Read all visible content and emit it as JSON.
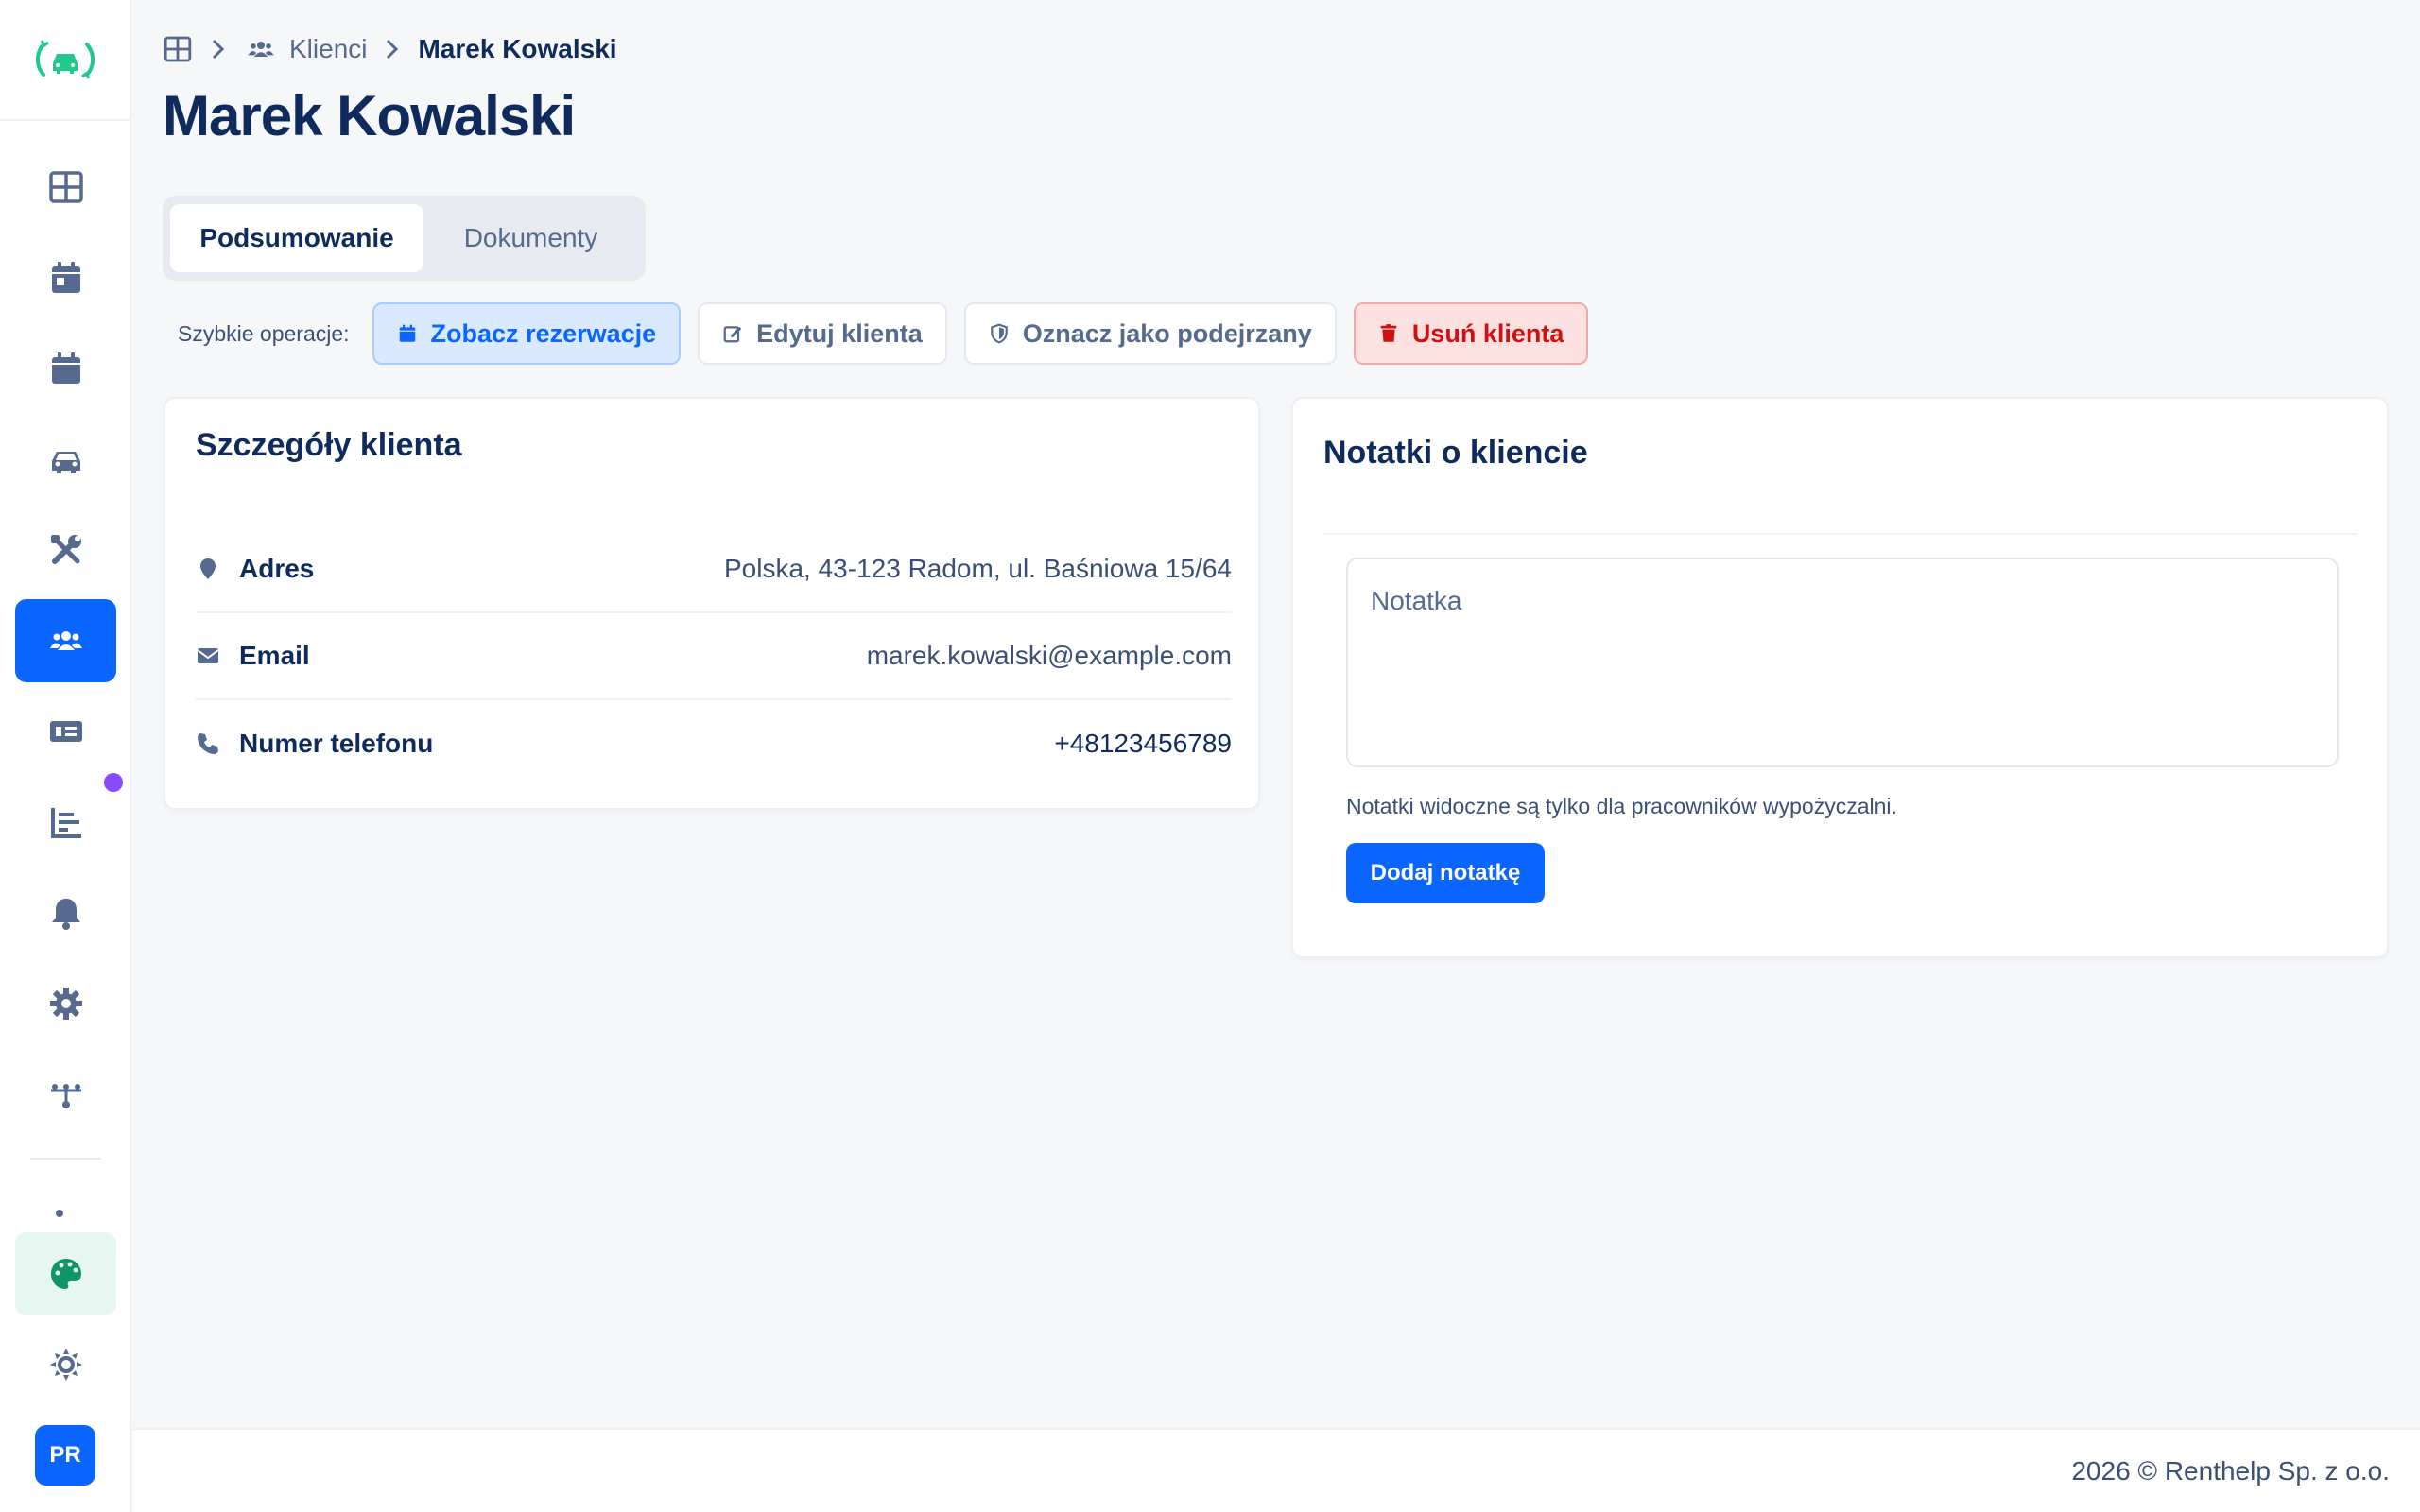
{
  "colors": {
    "accent": "#0a66ff",
    "brand_logo": "#1ec98b",
    "title_text": "#0f2a5c",
    "muted_text": "#56698f",
    "danger": "#d20f0f",
    "notification_dot": "#8a4bff"
  },
  "sidebar": {
    "items": [
      {
        "icon": "dashboard-icon"
      },
      {
        "icon": "calendar-day-icon"
      },
      {
        "icon": "calendar-icon"
      },
      {
        "icon": "car-icon"
      },
      {
        "icon": "tools-icon"
      },
      {
        "icon": "users-icon",
        "active": true
      },
      {
        "icon": "money-bill-icon"
      },
      {
        "icon": "chart-bar-icon"
      },
      {
        "icon": "bell-icon"
      },
      {
        "icon": "gear-icon"
      },
      {
        "icon": "network-icon"
      },
      {
        "icon": "palette-icon"
      },
      {
        "icon": "sun-icon"
      }
    ],
    "avatar_initials": "PR"
  },
  "breadcrumb": {
    "section": "Klienci",
    "current": "Marek Kowalski"
  },
  "page": {
    "title": "Marek Kowalski"
  },
  "tabs": {
    "summary": "Podsumowanie",
    "documents": "Dokumenty"
  },
  "quick_ops": {
    "label": "Szybkie operacje:",
    "view_reservations": "Zobacz rezerwacje",
    "edit_client": "Edytuj klienta",
    "mark_suspicious": "Oznacz jako podejrzany",
    "delete_client": "Usuń klienta"
  },
  "details": {
    "title": "Szczegóły klienta",
    "address_label": "Adres",
    "address_value": "Polska, 43-123 Radom, ul. Baśniowa 15/64",
    "email_label": "Email",
    "email_value": "marek.kowalski@example.com",
    "phone_label": "Numer telefonu",
    "phone_value": "+48123456789"
  },
  "notes": {
    "title": "Notatki o kliencie",
    "placeholder": "Notatka",
    "help_text": "Notatki widoczne są tylko dla pracowników wypożyczalni.",
    "add_button": "Dodaj notatkę"
  },
  "footer": {
    "text": "2026 © Renthelp Sp. z o.o."
  }
}
